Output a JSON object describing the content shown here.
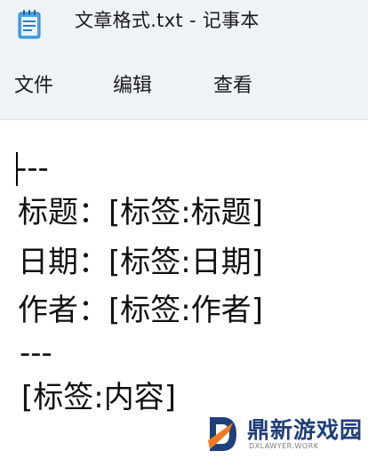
{
  "window": {
    "title": "文章格式.txt - 记事本",
    "icon": "notepad-icon"
  },
  "menu": {
    "items": [
      {
        "label": "文件"
      },
      {
        "label": "编辑"
      },
      {
        "label": "查看"
      }
    ]
  },
  "editor": {
    "lines": [
      "---",
      "标题：[标签:标题]",
      "日期：[标签:日期]",
      "作者：[标签:作者]",
      "---",
      "[标签:内容]"
    ]
  },
  "watermark": {
    "name": "鼎新游戏园",
    "domain": "DXLAWYER.WORK",
    "colors": {
      "primary": "#1f3f7a",
      "accent": "#f07b22"
    }
  },
  "colors": {
    "chrome_background": "#eef3f8",
    "editor_background": "#ffffff"
  }
}
